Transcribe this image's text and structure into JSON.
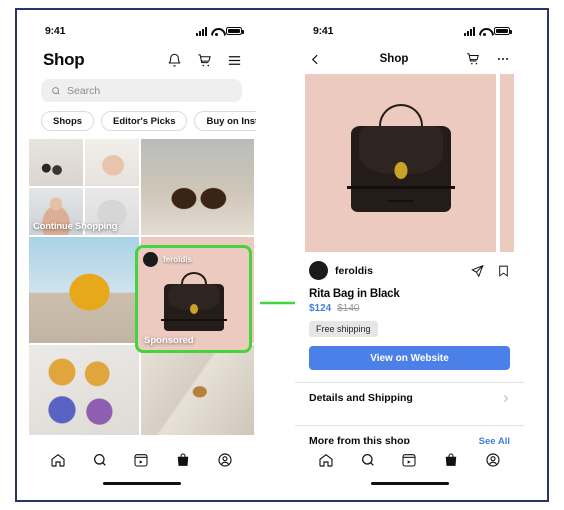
{
  "left_phone": {
    "status": {
      "time": "9:41",
      "signal_icon": "cellular-signal-icon",
      "wifi_icon": "wifi-icon",
      "battery_icon": "battery-icon"
    },
    "header": {
      "title": "Shop",
      "actions": [
        {
          "name": "notifications-icon",
          "label": "Notifications"
        },
        {
          "name": "shopping-cart-icon",
          "label": "Cart"
        },
        {
          "name": "menu-icon",
          "label": "Menu"
        }
      ]
    },
    "search": {
      "placeholder": "Search",
      "icon": "search-icon"
    },
    "chips": [
      "Shops",
      "Editor's Picks",
      "Buy on Instag"
    ],
    "feed": {
      "collage_label": "Continue Shopping",
      "tiles": [
        "candles-and-diffuser",
        "beige-sneaker",
        "woman-in-knitwear",
        "grey-sweater"
      ],
      "large_tile": "amber-spray-bottles",
      "outfit_tile": "yellow-tracksuit",
      "sunglasses_tile": "round-sunglasses-on-marble",
      "serum_tile": "serum-bottle-with-palm-shadow"
    },
    "sponsored_card": {
      "account": "feroldis",
      "tag": "Sponsored",
      "highlight_color": "#43d43f",
      "background_color": "#eccabf"
    },
    "tabbar": [
      {
        "name": "home-icon",
        "label": "Home",
        "active": false
      },
      {
        "name": "search-icon",
        "label": "Search",
        "active": false
      },
      {
        "name": "reels-icon",
        "label": "Reels",
        "active": false
      },
      {
        "name": "shop-bag-icon",
        "label": "Shop",
        "active": true
      },
      {
        "name": "profile-icon",
        "label": "Profile",
        "active": false
      }
    ]
  },
  "right_phone": {
    "status": {
      "time": "9:41"
    },
    "header": {
      "back_icon": "back-chevron-icon",
      "title": "Shop",
      "cart_icon": "shopping-cart-icon",
      "more_icon": "more-options-icon"
    },
    "hero": {
      "background_color": "#eccabf",
      "product_image": "rita-bag-in-black"
    },
    "account": {
      "name": "feroldis",
      "share_icon": "share-icon",
      "save_icon": "bookmark-icon"
    },
    "product": {
      "title": "Rita Bag in Black",
      "price_now": "$124",
      "price_was": "$140",
      "shipping_badge": "Free shipping",
      "cta_label": "View on Website",
      "cta_color": "#4a80e8",
      "price_color": "#3f7fe0"
    },
    "rows": [
      {
        "label": "Details and Shipping",
        "action": "",
        "chevron": true
      },
      {
        "label": "More from this shop",
        "action": "See All",
        "chevron": false
      }
    ],
    "tabbar": [
      {
        "name": "home-icon",
        "label": "Home",
        "active": false
      },
      {
        "name": "search-icon",
        "label": "Search",
        "active": false
      },
      {
        "name": "reels-icon",
        "label": "Reels",
        "active": false
      },
      {
        "name": "shop-bag-icon",
        "label": "Shop",
        "active": true
      },
      {
        "name": "profile-icon",
        "label": "Profile",
        "active": false
      }
    ]
  },
  "annotation": {
    "arrow_color": "#43d43f",
    "arrow_name": "flow-arrow"
  },
  "frame": {
    "border_color": "#2b3468"
  }
}
